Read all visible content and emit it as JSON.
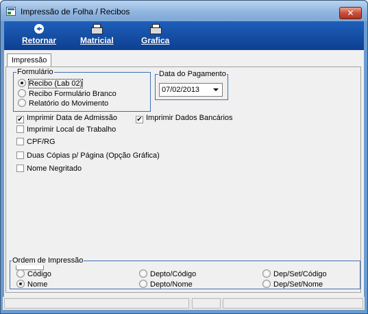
{
  "window": {
    "title": "Impressão de Folha / Recibos",
    "close_glyph": "✕"
  },
  "toolbar": {
    "buttons": [
      {
        "label": "Retornar",
        "icon": "back-arrow-icon"
      },
      {
        "label": "Matricial",
        "icon": "printer-icon"
      },
      {
        "label": "Grafica",
        "icon": "printer-icon"
      }
    ]
  },
  "tabs": [
    {
      "label": "Impressão",
      "active": true
    }
  ],
  "formulario": {
    "legend": "Formulário",
    "options": [
      {
        "label": "Recibo (Lab 02)",
        "selected": true
      },
      {
        "label": "Recibo Formulário Branco",
        "selected": false
      },
      {
        "label": "Relatório do Movimento",
        "selected": false
      }
    ]
  },
  "pagamento": {
    "legend": "Data do Pagamento",
    "date": "07/02/2013"
  },
  "options": {
    "imprimir_data_admissao": {
      "label": "Imprimir Data de Admissão",
      "checked": true
    },
    "imprimir_dados_bancarios": {
      "label": "Imprimir Dados Bancários",
      "checked": true
    },
    "imprimir_local_trabalho": {
      "label": "Imprimir Local de Trabalho",
      "checked": false
    },
    "cpf_rg": {
      "label": "CPF/RG",
      "checked": false
    },
    "duas_copias": {
      "label": "Duas Cópias p/ Página (Opção Gráfica)",
      "checked": false
    },
    "nome_negritado": {
      "label": "Nome Negritado",
      "checked": false
    }
  },
  "ordem": {
    "legend": "Ordem de Impressão",
    "options": [
      {
        "label": "Código",
        "selected": false
      },
      {
        "label": "Nome",
        "selected": true
      },
      {
        "label": "Depto/Código",
        "selected": false
      },
      {
        "label": "Depto/Nome",
        "selected": false
      },
      {
        "label": "Dep/Set/Código",
        "selected": false
      },
      {
        "label": "Dep/Set/Nome",
        "selected": false
      }
    ]
  },
  "colors": {
    "toolbar": "#1f5fb9",
    "groupbox_border": "#3d6fb6",
    "close_button": "#c9503b"
  }
}
